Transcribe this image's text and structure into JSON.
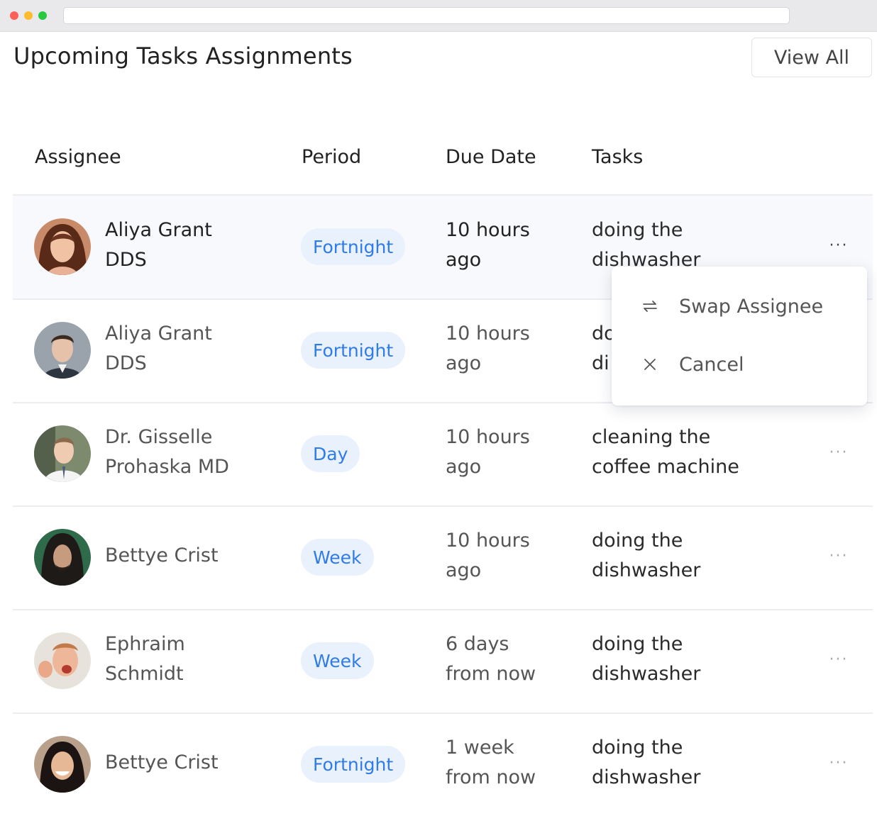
{
  "header": {
    "title": "Upcoming Tasks Assignments",
    "view_all_label": "View All"
  },
  "table": {
    "columns": [
      "Assignee",
      "Period",
      "Due Date",
      "Tasks"
    ],
    "rows": [
      {
        "assignee": [
          "Aliya Grant",
          "DDS"
        ],
        "period": "Fortnight",
        "due": [
          "10 hours",
          "ago"
        ],
        "task": [
          "doing the",
          "dishwasher"
        ]
      },
      {
        "assignee": [
          "Aliya Grant",
          "DDS"
        ],
        "period": "Fortnight",
        "due": [
          "10 hours",
          "ago"
        ],
        "task": [
          "do",
          "di"
        ]
      },
      {
        "assignee": [
          "Dr. Gisselle",
          "Prohaska MD"
        ],
        "period": "Day",
        "due": [
          "10 hours",
          "ago"
        ],
        "task": [
          "cleaning the",
          "coffee machine"
        ]
      },
      {
        "assignee": [
          "Bettye Crist"
        ],
        "period": "Week",
        "due": [
          "10 hours",
          "ago"
        ],
        "task": [
          "doing the",
          "dishwasher"
        ]
      },
      {
        "assignee": [
          "Ephraim",
          "Schmidt"
        ],
        "period": "Week",
        "due": [
          "6 days",
          "from now"
        ],
        "task": [
          "doing the",
          "dishwasher"
        ]
      },
      {
        "assignee": [
          "Bettye Crist"
        ],
        "period": "Fortnight",
        "due": [
          "1 week",
          "from now"
        ],
        "task": [
          "doing the",
          "dishwasher"
        ]
      }
    ],
    "more_glyph": "···"
  },
  "context_menu": {
    "items": [
      {
        "label": "Swap Assignee",
        "icon": "swap-icon"
      },
      {
        "label": "Cancel",
        "icon": "close-icon"
      }
    ]
  },
  "colors": {
    "badge_bg": "#e9f1fd",
    "badge_text": "#2f7be8",
    "highlight_row": "#f7f9fc"
  }
}
